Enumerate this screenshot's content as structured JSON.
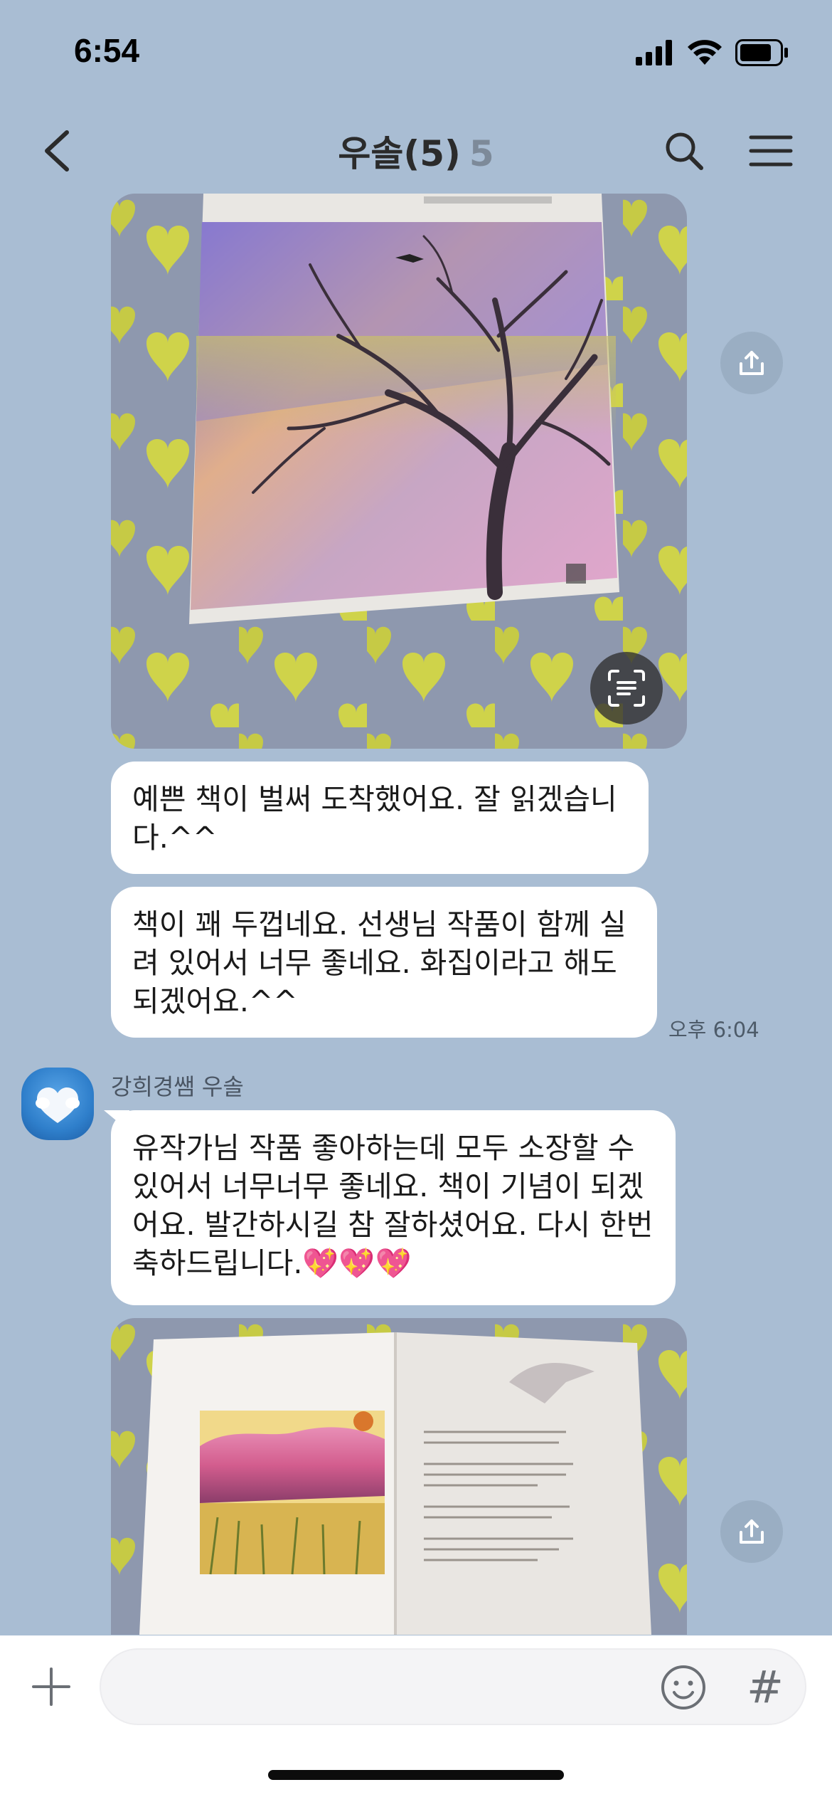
{
  "status_bar": {
    "time": "6:54",
    "battery_level": 0.8
  },
  "header": {
    "title": "우솔(5)",
    "member_count": "5"
  },
  "messages": {
    "bubble1": "예쁜 책이 벌써 도착했어요. 잘 읽겠습니다.^^",
    "bubble2": "책이 꽤 두껍네요. 선생님 작품이 함께 실려 있어서 너무 좋네요. 화집이라고 해도 되겠어요.^^",
    "timestamp": "오후 6:04",
    "sender_name": "강희경쌤 우솔",
    "bubble3": "유작가님 작품 좋아하는데 모두 소장할 수 있어서 너무너무 좋네요. 책이 기념이 되겠어요. 발간하시길 참 잘하셨어요. 다시 한번 축하드립니다.💖💖💖"
  },
  "input": {
    "placeholder": "",
    "hash_label": "#"
  },
  "colors": {
    "chat_background": "#a9bdd3",
    "bubble": "#ffffff",
    "header_count": "#7d8a99"
  },
  "icons": {
    "back": "chevron-left-icon",
    "search": "search-icon",
    "menu": "hamburger-menu-icon",
    "share": "share-icon",
    "scan": "text-scan-icon",
    "plus": "plus-icon",
    "emoji": "emoji-icon"
  }
}
